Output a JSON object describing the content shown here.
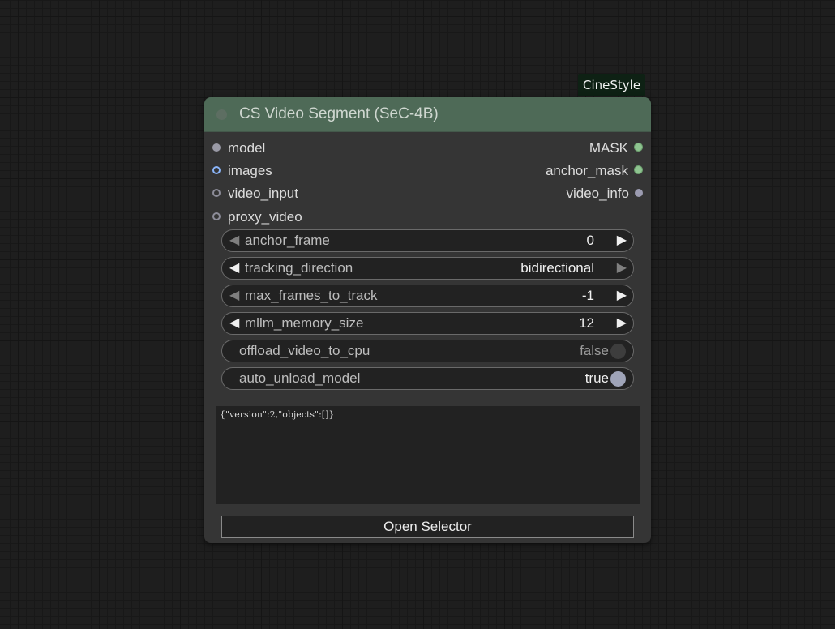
{
  "badge": "CineStyle",
  "node": {
    "title": "CS Video Segment (SeC-4B)",
    "inputs": [
      "model",
      "images",
      "video_input",
      "proxy_video"
    ],
    "outputs": [
      "MASK",
      "anchor_mask",
      "video_info"
    ],
    "widgets": {
      "anchor_frame": {
        "label": "anchor_frame",
        "value": "0"
      },
      "tracking_direction": {
        "label": "tracking_direction",
        "value": "bidirectional"
      },
      "max_frames_to_track": {
        "label": "max_frames_to_track",
        "value": "-1"
      },
      "mllm_memory_size": {
        "label": "mllm_memory_size",
        "value": "12"
      },
      "offload_video_to_cpu": {
        "label": "offload_video_to_cpu",
        "value": "false"
      },
      "auto_unload_model": {
        "label": "auto_unload_model",
        "value": "true"
      }
    },
    "textarea_value": "{\"version\":2,\"objects\":[]}",
    "button_label": "Open Selector"
  },
  "colors": {
    "title_bar": "#4e6a57",
    "node_body": "#353535",
    "output_green": "#8ec490",
    "input_blue": "#8ab4f8"
  },
  "icons": {
    "decrement": "triangle-left-icon",
    "increment": "triangle-right-icon"
  }
}
